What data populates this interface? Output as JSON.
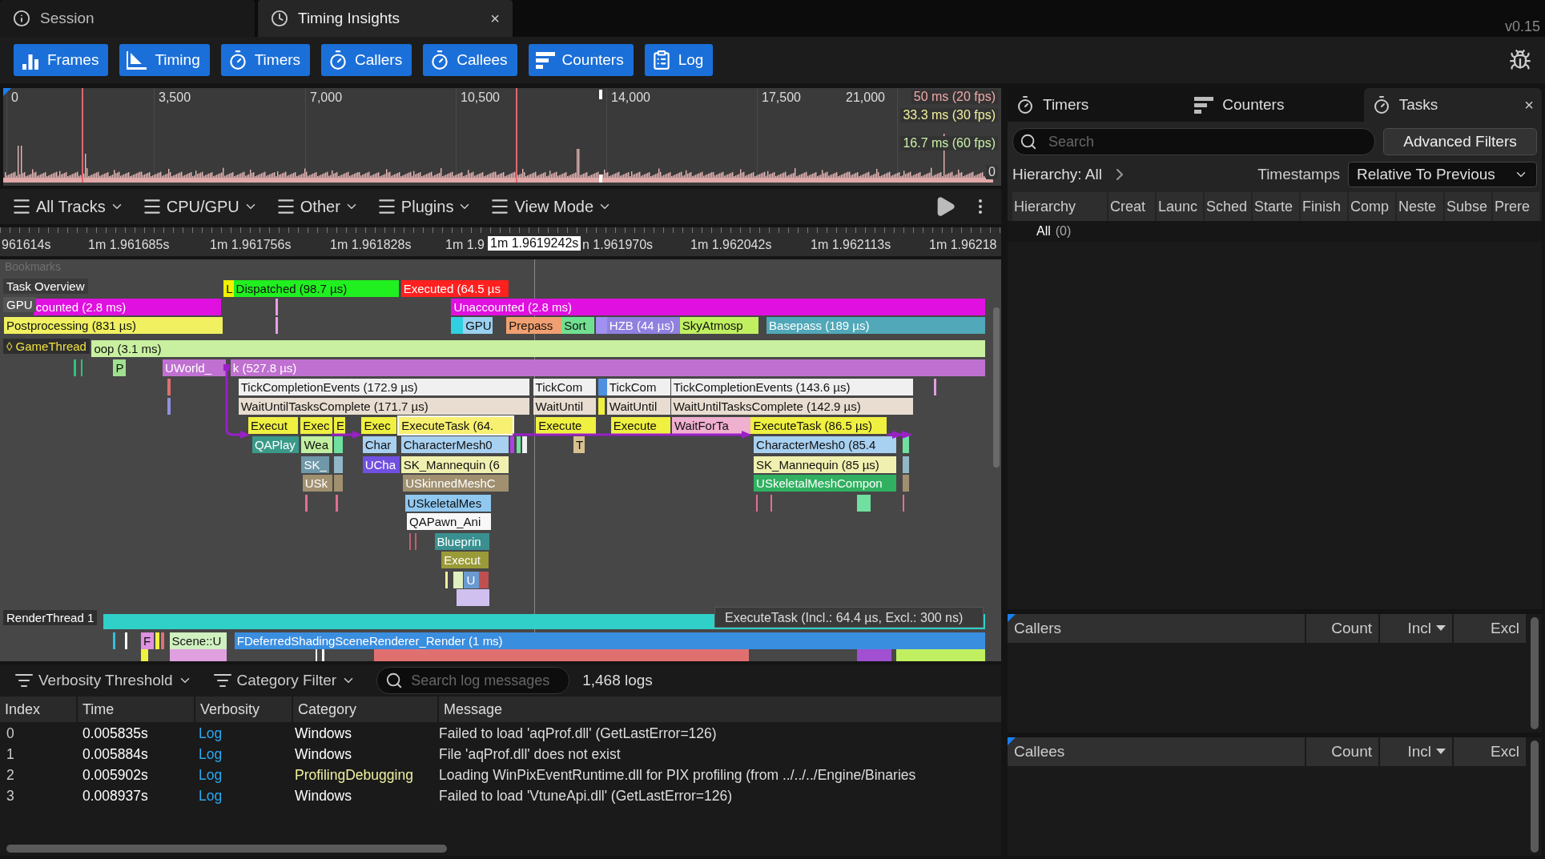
{
  "tabs": [
    {
      "label": "Session",
      "selected": false
    },
    {
      "label": "Timing Insights",
      "selected": true,
      "close": "×"
    }
  ],
  "version": "v0.15",
  "toolbar": [
    "Frames",
    "Timing",
    "Timers",
    "Callers",
    "Callees",
    "Counters",
    "Log"
  ],
  "frames_graph": {
    "ticks": [
      "0",
      "3,500",
      "7,000",
      "10,500",
      "14,000",
      "17,500",
      "21,000"
    ],
    "thresholds": [
      "50 ms (20 fps)",
      "33.3 ms (30 fps)",
      "16.7 ms (60 fps)"
    ],
    "zero": "0"
  },
  "track_menus": [
    "All Tracks",
    "CPU/GPU",
    "Other",
    "Plugins",
    "View Mode"
  ],
  "ruler": {
    "labels": [
      "961614s",
      "1m 1.961685s",
      "1m 1.961756s",
      "1m 1.961828s",
      "1m 1.9",
      "n 1.961970s",
      "1m 1.962042s",
      "1m 1.962113s",
      "1m 1.96218"
    ],
    "cursor": "1m 1.9619242s"
  },
  "timeline": {
    "bookmarks": "Bookmarks",
    "tracks": [
      "Task Overview",
      "GPU",
      "◊ GameThread",
      "RenderThread 1"
    ],
    "events": [
      {
        "label": "L",
        "color": "#f0f000",
        "selected": false
      },
      {
        "label": "Dispatched (98.7 µs)",
        "color": "#20f020",
        "selected": false
      },
      {
        "label": "Executed (64.5 µs",
        "color": "#ff2020",
        "selected": false
      },
      {
        "label": "counted (2.8 ms)",
        "color": "#e010e0",
        "selected": false
      },
      {
        "label": "Unaccounted (2.8 ms)",
        "color": "#e010e0",
        "selected": false
      },
      {
        "label": "Postprocessing (831 µs)",
        "color": "#f0f060",
        "selected": false
      },
      {
        "label": "GPU",
        "color": "#9ad0f0",
        "selected": false
      },
      {
        "label": "Prepass",
        "color": "#f0a070",
        "selected": false
      },
      {
        "label": "Sort",
        "color": "#70e090",
        "selected": false
      },
      {
        "label": "HZB (44 µs)",
        "color": "#9080e0",
        "selected": false
      },
      {
        "label": "SkyAtmosp",
        "color": "#c0f060",
        "selected": false
      },
      {
        "label": "Basepass (189 µs)",
        "color": "#50a8b8",
        "selected": false
      },
      {
        "label": "oop (3.1 ms)",
        "color": "#c8f0a0",
        "selected": false
      },
      {
        "label": "P",
        "color": "#a0e090",
        "selected": false
      },
      {
        "label": "UWorld_",
        "color": "#c070d0",
        "selected": false
      },
      {
        "label": "k (527.8 µs)",
        "color": "#c070d0",
        "selected": false
      },
      {
        "label": "TickCompletionEvents (172.9 µs)",
        "color": "#f0f0f0",
        "selected": false
      },
      {
        "label": "TickCom",
        "color": "#f0f0f0",
        "selected": false
      },
      {
        "label": "TickCom",
        "color": "#f0f0f0",
        "selected": false
      },
      {
        "label": "TickCompletionEvents (143.6 µs)",
        "color": "#f0f0f0",
        "selected": false
      },
      {
        "label": "WaitUntilTasksComplete (171.7 µs)",
        "color": "#e8ddd0",
        "selected": false
      },
      {
        "label": "WaitUntil",
        "color": "#e8ddd0",
        "selected": false
      },
      {
        "label": "WaitUntil",
        "color": "#e8ddd0",
        "selected": false
      },
      {
        "label": "WaitUntilTasksComplete (142.9 µs)",
        "color": "#e8ddd0",
        "selected": false
      },
      {
        "label": "Execut",
        "color": "#f0f040",
        "selected": false
      },
      {
        "label": "Exec",
        "color": "#f0f040",
        "selected": false
      },
      {
        "label": "E",
        "color": "#f0f040",
        "selected": false
      },
      {
        "label": "Exec",
        "color": "#f0f040",
        "selected": false
      },
      {
        "label": "ExecuteTask (64.",
        "color": "#f8f070",
        "selected": true
      },
      {
        "label": "Execute",
        "color": "#f0f040",
        "selected": false
      },
      {
        "label": "Execute",
        "color": "#f0f040",
        "selected": false
      },
      {
        "label": "WaitForTa",
        "color": "#f0b0d0",
        "selected": false
      },
      {
        "label": "ExecuteTask (86.5 µs)",
        "color": "#f0f040",
        "selected": false
      },
      {
        "label": "QAPlay",
        "color": "#3a9a8a",
        "selected": false
      },
      {
        "label": "Wea",
        "color": "#c0f0a0",
        "selected": false
      },
      {
        "label": "Char",
        "color": "#a8d0f0",
        "selected": false
      },
      {
        "label": "CharacterMesh0",
        "color": "#a8d0f0",
        "selected": false
      },
      {
        "label": "T",
        "color": "#d8c090",
        "selected": false
      },
      {
        "label": "CharacterMesh0 (85.4",
        "color": "#a8d0f0",
        "selected": false
      },
      {
        "label": "SK_",
        "color": "#6f98a8",
        "selected": false
      },
      {
        "label": "UCha",
        "color": "#7050e0",
        "selected": false
      },
      {
        "label": "SK_Mannequin (6",
        "color": "#f0f0b0",
        "selected": false
      },
      {
        "label": "SK_Mannequin (85 µs)",
        "color": "#f0f0b0",
        "selected": false
      },
      {
        "label": "USk",
        "color": "#a09070",
        "selected": false
      },
      {
        "label": "USkinnedMeshC",
        "color": "#a09070",
        "selected": false
      },
      {
        "label": "USkeletalMeshCompon",
        "color": "#30b060",
        "selected": false
      },
      {
        "label": "USkeletalMes",
        "color": "#90c8f0",
        "selected": false
      },
      {
        "label": "QAPawn_Ani",
        "color": "#f8f8f8",
        "selected": false
      },
      {
        "label": "Blueprin",
        "color": "#3a9090",
        "selected": false
      },
      {
        "label": "Execut",
        "color": "#9a9a38",
        "selected": false
      },
      {
        "label": "U",
        "color": "#6a9ad0",
        "selected": false
      },
      {
        "label": "F",
        "color": "#e090e0",
        "selected": false
      },
      {
        "label": "Scene::U",
        "color": "#d0f0c0",
        "selected": false
      },
      {
        "label": "FDeferredShadingSceneRenderer_Render (1 ms)",
        "color": "#3a8ee0",
        "selected": false
      }
    ],
    "tooltip": "ExecuteTask (Incl.: 64.4 µs, Excl.: 300 ns)"
  },
  "log": {
    "filters": [
      "Verbosity Threshold",
      "Category Filter"
    ],
    "search": {
      "placeholder": "Search log messages"
    },
    "count": "1,468 logs",
    "columns": [
      "Index",
      "Time",
      "Verbosity",
      "Category",
      "Message"
    ],
    "rows": [
      {
        "index": "0",
        "time": "0.005835s",
        "verbosity": "Log",
        "category": "Windows",
        "color": "#ffffff",
        "message": "Failed to load 'aqProf.dll' (GetLastError=126)"
      },
      {
        "index": "1",
        "time": "0.005884s",
        "verbosity": "Log",
        "category": "Windows",
        "color": "#ffffff",
        "message": "File 'aqProf.dll' does not exist"
      },
      {
        "index": "2",
        "time": "0.005902s",
        "verbosity": "Log",
        "category": "ProfilingDebugging",
        "color": "#f0f0a0",
        "message": "Loading WinPixEventRuntime.dll for PIX profiling (from ../../../Engine/Binaries"
      },
      {
        "index": "3",
        "time": "0.008937s",
        "verbosity": "Log",
        "category": "Windows",
        "color": "#ffffff",
        "message": "Failed to load 'VtuneApi.dll' (GetLastError=126)"
      }
    ]
  },
  "side": {
    "tabs": [
      {
        "label": "Timers",
        "selected": false
      },
      {
        "label": "Counters",
        "selected": false
      },
      {
        "label": "Tasks",
        "selected": true
      }
    ],
    "close": "×",
    "search": {
      "placeholder": "Search"
    },
    "advanced_filters": "Advanced Filters",
    "hierarchy": "Hierarchy: All",
    "timestamps_label": "Timestamps",
    "timestamps_value": "Relative To Previous",
    "columns": [
      "Hierarchy",
      "Creat",
      "Launc",
      "Sched",
      "Starte",
      "Finish",
      "Comp",
      "Neste",
      "Subse",
      "Prere"
    ],
    "tree": [
      {
        "label": "All",
        "count": "(0)"
      }
    ]
  },
  "callers": {
    "columns": [
      "Callers",
      "Count",
      "Incl",
      "Excl"
    ]
  },
  "callees": {
    "columns": [
      "Callees",
      "Count",
      "Incl",
      "Excl"
    ]
  }
}
